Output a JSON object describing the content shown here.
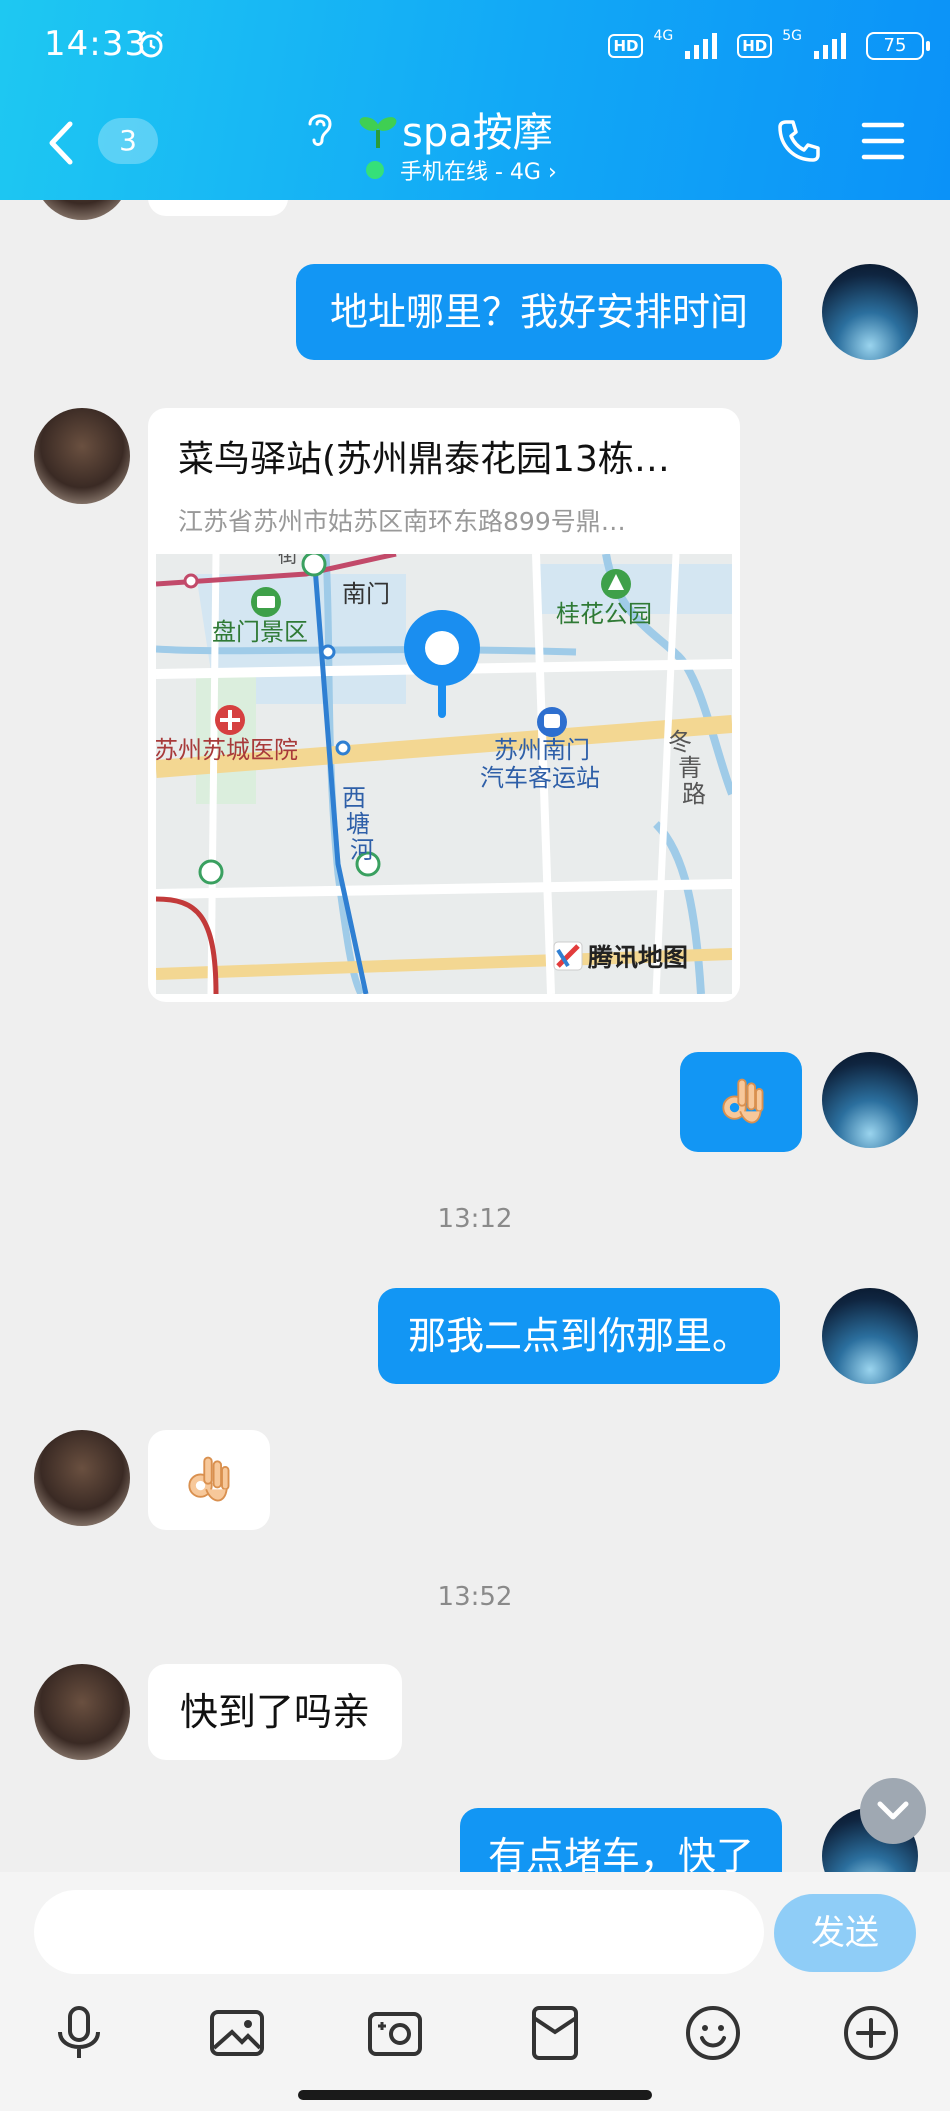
{
  "status": {
    "time": "14:33",
    "hd1": "HD",
    "net1": "4G",
    "hd2": "HD",
    "net2": "5G",
    "battery": "75"
  },
  "header": {
    "unread": "3",
    "contact_name": "spa按摩",
    "presence": "手机在线 - 4G ›"
  },
  "messages": {
    "m1": "地址哪里？我好安排时间",
    "location_title": "菜鸟驿站(苏州鼎泰花园13栋…",
    "location_address": "江苏省苏州市姑苏区南环东路899号鼎…",
    "ts1": "13:12",
    "m3": "那我二点到你那里。",
    "ts2": "13:52",
    "m5": "快到了吗亲",
    "m6": "有点堵车，快了"
  },
  "map": {
    "labels": [
      "南门",
      "盘门景区",
      "桂花公园",
      "苏州苏城医院",
      "苏州南门",
      "汽车客运站",
      "西",
      "塘",
      "河",
      "冬",
      "青",
      "路",
      "街"
    ],
    "brand": "腾讯地图"
  },
  "input": {
    "placeholder": "",
    "send_label": "发送"
  },
  "icons": [
    "back-icon",
    "ear-icon",
    "sprout-icon",
    "phone-icon",
    "menu-icon",
    "voice-icon",
    "image-icon",
    "camera-icon",
    "red-packet-icon",
    "emoji-icon",
    "plus-icon",
    "chevron-down-icon",
    "ok-hand-icon"
  ],
  "colors": {
    "header_start": "#1ec8f2",
    "header_end": "#0b92f8",
    "bubble_out": "#1296f4",
    "bubble_in": "#ffffff",
    "send_button": "#8fcdf7",
    "online_dot": "#35e07a"
  }
}
